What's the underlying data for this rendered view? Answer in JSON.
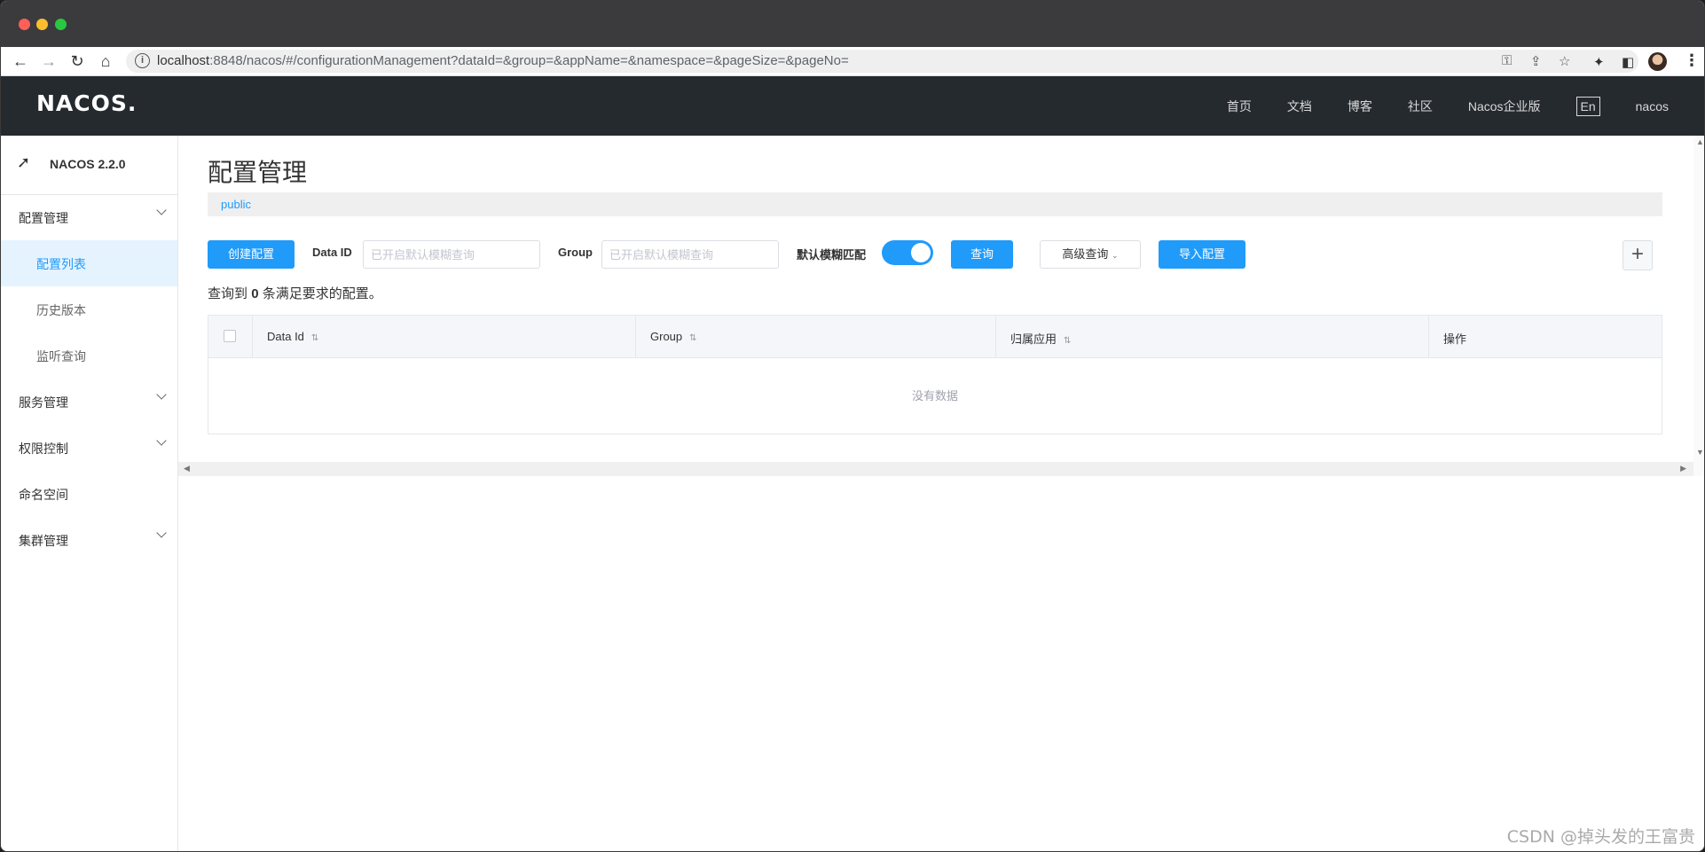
{
  "browser": {
    "url_host": "localhost",
    "url_rest": ":8848/nacos/#/configurationManagement?dataId=&group=&appName=&namespace=&pageSize=&pageNo="
  },
  "header": {
    "logo": "NACOS.",
    "nav": [
      "首页",
      "文档",
      "博客",
      "社区",
      "Nacos企业版"
    ],
    "lang": "En",
    "user": "nacos"
  },
  "sidebar": {
    "version": "NACOS 2.2.0",
    "items": [
      {
        "label": "配置管理"
      },
      {
        "label": "配置列表"
      },
      {
        "label": "历史版本"
      },
      {
        "label": "监听查询"
      },
      {
        "label": "服务管理"
      },
      {
        "label": "权限控制"
      },
      {
        "label": "命名空间"
      },
      {
        "label": "集群管理"
      }
    ]
  },
  "main": {
    "title": "配置管理",
    "namespace": "public",
    "create_button": "创建配置",
    "dataid_label": "Data ID",
    "dataid_placeholder": "已开启默认模糊查询",
    "group_label": "Group",
    "group_placeholder": "已开启默认模糊查询",
    "fuzzy_label": "默认模糊匹配",
    "fuzzy_enabled": true,
    "search_button": "查询",
    "advanced_button": "高级查询",
    "import_button": "导入配置",
    "result_prefix": "查询到",
    "result_count": "0",
    "result_suffix": "条满足要求的配置。",
    "table": {
      "columns": [
        "Data Id",
        "Group",
        "归属应用",
        "操作"
      ],
      "empty_text": "没有数据"
    }
  },
  "watermark": "CSDN @掉头发的王富贵"
}
